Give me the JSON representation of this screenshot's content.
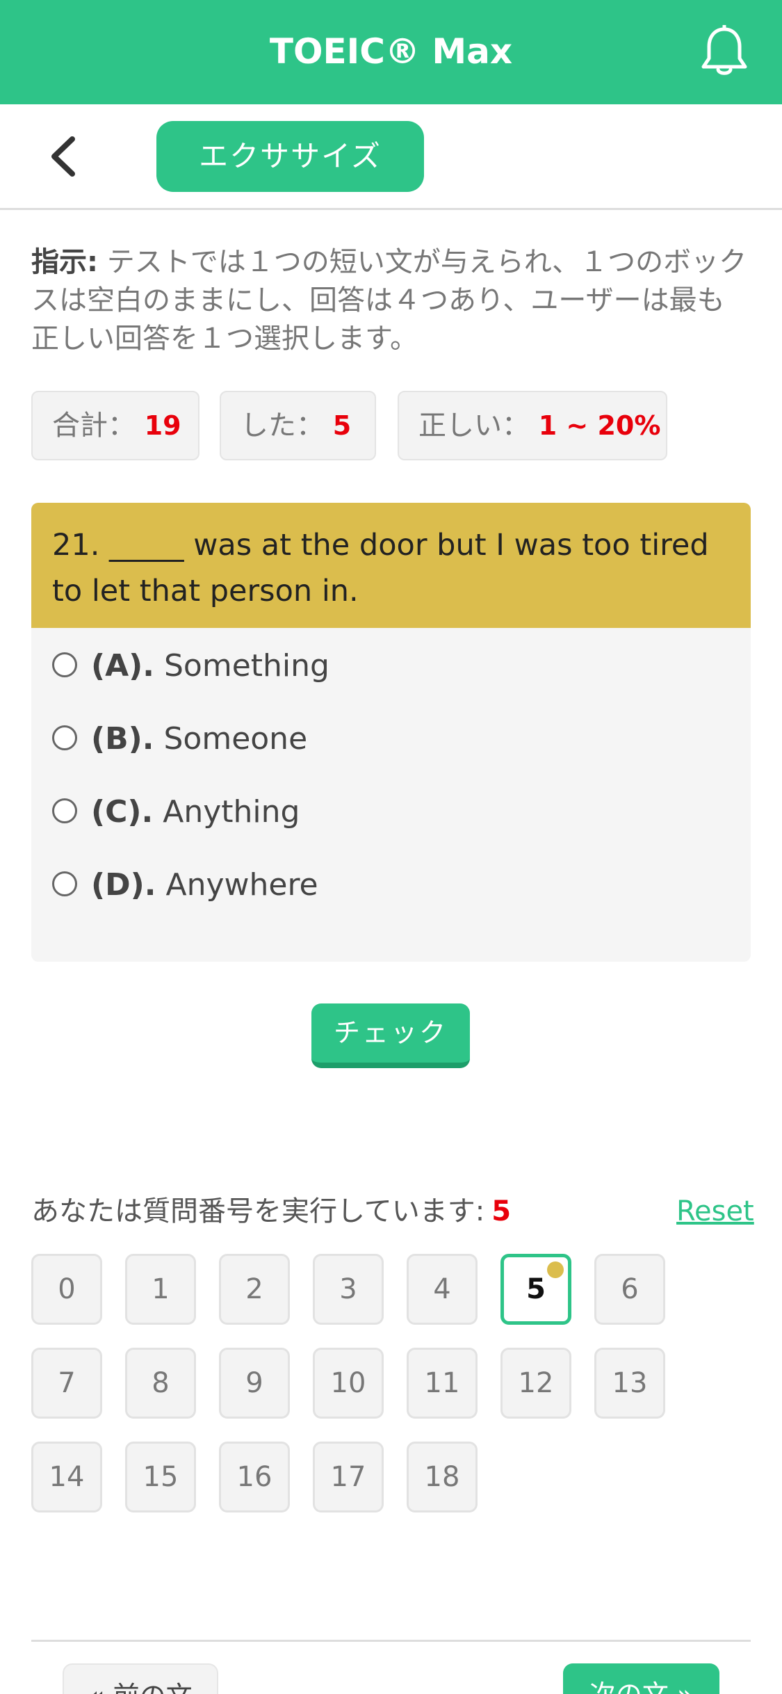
{
  "header": {
    "app_title": "TOEIC® Max",
    "bell_icon": "bell-icon"
  },
  "subnav": {
    "back_icon": "chevron-left-icon",
    "section_label": "エクササイズ"
  },
  "instructions": {
    "label": "指示:",
    "text": " テストでは１つの短い文が与えられ、１つのボックスは空白のままにし、回答は４つあり、ユーザーは最も正しい回答を１つ選択します。"
  },
  "stats": [
    {
      "label": "合計：",
      "value": "19"
    },
    {
      "label": "した：",
      "value": "5"
    },
    {
      "label": "正しい：",
      "value": "1 ~ 20%"
    }
  ],
  "question": {
    "text": "21. _____ was at the door but I was too tired to let that person in.",
    "options": [
      {
        "letter": "(A).",
        "text": "Something"
      },
      {
        "letter": "(B).",
        "text": "Someone"
      },
      {
        "letter": "(C).",
        "text": "Anything"
      },
      {
        "letter": "(D).",
        "text": "Anywhere"
      }
    ]
  },
  "check_label": "チェック",
  "progress": {
    "label": "あなたは質問番号を実行しています:",
    "current": "5",
    "reset_label": "Reset"
  },
  "question_numbers": [
    "0",
    "1",
    "2",
    "3",
    "4",
    "5",
    "6",
    "7",
    "8",
    "9",
    "10",
    "11",
    "12",
    "13",
    "14",
    "15",
    "16",
    "17",
    "18"
  ],
  "nav": {
    "prev_label": "« 前の文",
    "next_label": "次の文 »"
  },
  "colors": {
    "primary": "#2ec488",
    "question_header": "#dbbd4d",
    "highlight_number": "#e8000b"
  }
}
